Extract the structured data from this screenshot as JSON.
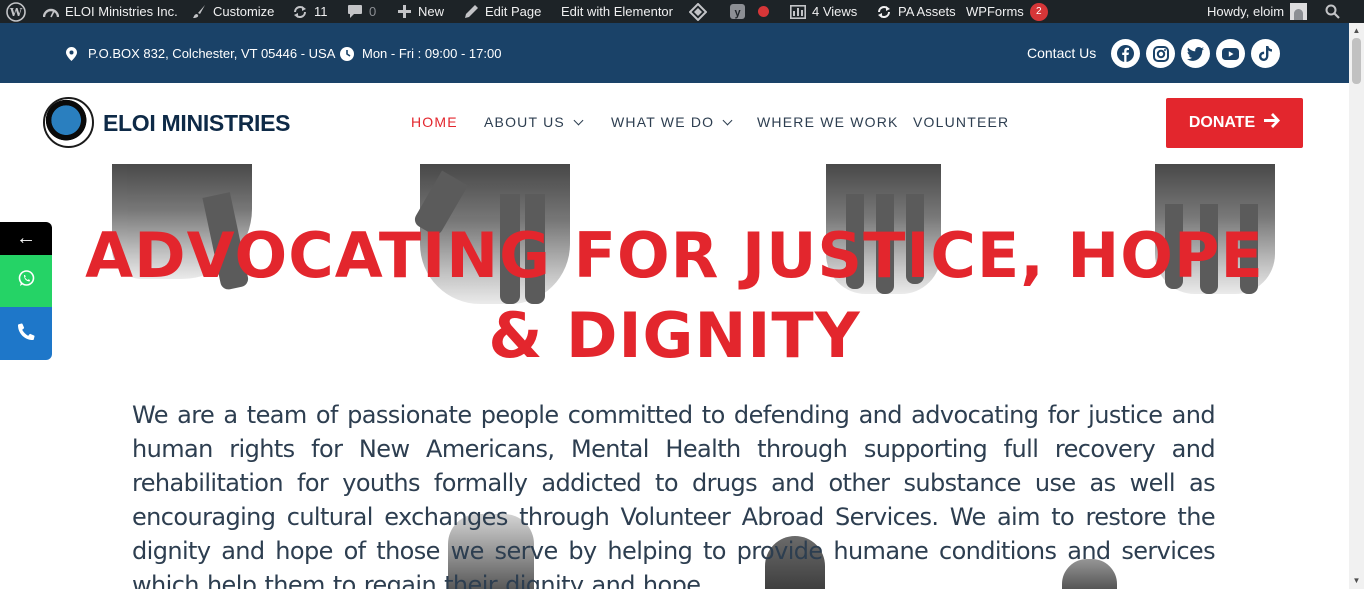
{
  "admin_bar": {
    "site_name": "ELOI Ministries Inc.",
    "customize": "Customize",
    "updates_count": "11",
    "comments_count": "0",
    "new_label": "New",
    "edit_page": "Edit Page",
    "edit_elementor": "Edit with Elementor",
    "views": "4 Views",
    "pa_assets": "PA Assets",
    "wpforms": "WPForms",
    "wpforms_badge": "2",
    "howdy": "Howdy, eloim"
  },
  "topbar": {
    "address": "P.O.BOX 832, Colchester, VT 05446 - USA",
    "hours": "Mon - Fri : 09:00 - 17:00",
    "contact": "Contact Us",
    "social_icons": [
      "facebook-icon",
      "instagram-icon",
      "twitter-icon",
      "youtube-icon",
      "tiktok-icon"
    ]
  },
  "header": {
    "logo_text": "ELOI MINISTRIES",
    "nav": [
      {
        "label": "HOME"
      },
      {
        "label": "ABOUT US"
      },
      {
        "label": "WHAT WE DO"
      },
      {
        "label": "WHERE WE WORK"
      },
      {
        "label": "VOLUNTEER"
      }
    ],
    "donate_label": "DONATE"
  },
  "hero": {
    "title_line1": "ADVOCATING FOR JUSTICE, HOPE",
    "title_line2": "& DIGNITY",
    "body": "We are a team of passionate people committed to defending and advocating for justice and human rights for New Americans, Mental Health through supporting full recovery and rehabilitation for youths formally addicted to drugs and other substance use as well as encouraging cultural exchanges through Volunteer Abroad Services. We aim to restore the dignity and hope of those we serve by helping to provide humane conditions and services which help them to regain their dignity and hope."
  },
  "side_buttons": {
    "back_glyph": "←"
  },
  "colors": {
    "accent": "#e3262d",
    "navy": "#1a4268",
    "adminbar": "#1d2327",
    "whatsapp": "#25d366",
    "phone": "#1e77c9"
  }
}
